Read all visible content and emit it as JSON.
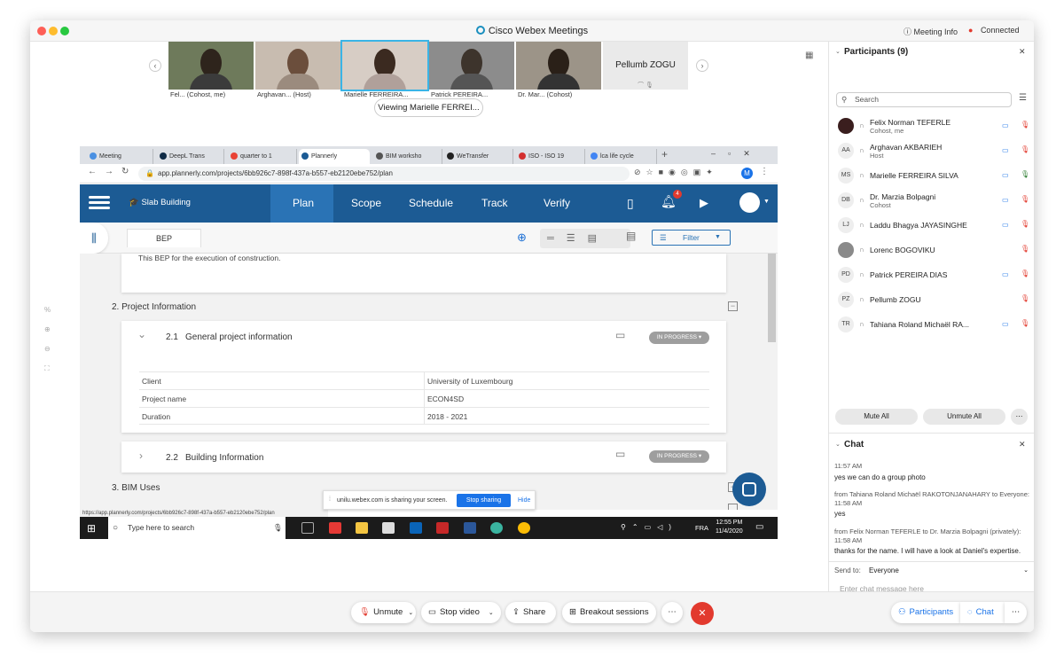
{
  "window": {
    "title": "Cisco Webex Meetings",
    "meeting_info": "Meeting Info",
    "connected": "Connected"
  },
  "video_strip": {
    "thumbs": [
      {
        "name": "Fel...",
        "role": "(Cohost, me)"
      },
      {
        "name": "Arghavan...",
        "role": "(Host)"
      },
      {
        "name": "Marielle FERREIRA...",
        "role": ""
      },
      {
        "name": "Patrick PEREIRA...",
        "role": ""
      },
      {
        "name": "Dr. Mar...",
        "role": "(Cohost)"
      }
    ],
    "tile_name": "Pellumb ZOGU",
    "viewing": "Viewing Marielle FERREI..."
  },
  "browser": {
    "tabs": [
      "Meeting",
      "DeepL Trans",
      "quarter to 1",
      "Plannerly",
      "BIM worksho",
      "WeTransfer",
      "ISO - ISO 19",
      "lca life cycle"
    ],
    "url": "app.plannerly.com/projects/6bb926c7-898f-437a-b557-eb2120ebe752/plan",
    "status_url": "https://app.plannerly.com/projects/6bb926c7-898f-437a-b557-eb2120ebe752/plan"
  },
  "plannerly": {
    "project": "Slab Building",
    "nav": [
      "Plan",
      "Scope",
      "Schedule",
      "Track",
      "Verify"
    ],
    "notif_count": "4",
    "tab": "BEP",
    "filter": "Filter",
    "intro_text": "This BEP for the execution of construction.",
    "section2": "2. Project Information",
    "sub21_num": "2.1",
    "sub21_title": "General project information",
    "status": "IN PROGRESS",
    "table": [
      {
        "label": "Client",
        "value": "University of Luxembourg"
      },
      {
        "label": "Project name",
        "value": "ECON4SD"
      },
      {
        "label": "Duration",
        "value": "2018 - 2021"
      }
    ],
    "sub22_num": "2.2",
    "sub22_title": "Building Information",
    "section3": "3. BIM Uses",
    "sharing_text": "unilu.webex.com is sharing your screen.",
    "stop_sharing": "Stop sharing",
    "hide": "Hide"
  },
  "taskbar": {
    "search": "Type here to search",
    "lang": "FRA",
    "time": "12:55 PM",
    "date": "11/4/2020"
  },
  "participants": {
    "title": "Participants (9)",
    "search_placeholder": "Search",
    "list": [
      {
        "name": "Felix Norman TEFERLE",
        "role": "Cohost, me",
        "initials": ""
      },
      {
        "name": "Arghavan AKBARIEH",
        "role": "Host",
        "initials": "AA"
      },
      {
        "name": "Marielle FERREIRA SILVA",
        "role": "",
        "initials": "MS"
      },
      {
        "name": "Dr. Marzia Bolpagni",
        "role": "Cohost",
        "initials": "DB"
      },
      {
        "name": "Laddu Bhagya JAYASINGHE",
        "role": "",
        "initials": "LJ"
      },
      {
        "name": "Lorenc BOGOVIKU",
        "role": "",
        "initials": ""
      },
      {
        "name": "Patrick PEREIRA DIAS",
        "role": "",
        "initials": "PD"
      },
      {
        "name": "Pellumb ZOGU",
        "role": "",
        "initials": "PZ"
      },
      {
        "name": "Tahiana Roland Michaël RA...",
        "role": "",
        "initials": "TR"
      }
    ],
    "mute_all": "Mute All",
    "unmute_all": "Unmute All"
  },
  "chat": {
    "title": "Chat",
    "messages": [
      {
        "meta": "11:57  AM",
        "text": "yes we can do a group photo"
      },
      {
        "meta": "from Tahiana Roland Michaël RAKOTONJANAHARY to Everyone:",
        "time": "11:58  AM",
        "text": "yes"
      },
      {
        "meta": "from Felix Norman TEFERLE to Dr. Marzia Bolpagni (privately):",
        "time": "11:58  AM",
        "text": "thanks for the name. I will have a look at Daniel's expertise."
      }
    ],
    "send_to_label": "Send to:",
    "send_to_value": "Everyone",
    "placeholder": "Enter chat message here"
  },
  "controls": {
    "unmute": "Unmute",
    "stop_video": "Stop video",
    "share": "Share",
    "breakout": "Breakout sessions",
    "participants": "Participants",
    "chat": "Chat"
  },
  "colors": {
    "accent": "#1c5b94",
    "end_call": "#e23a2e",
    "webex_blue": "#0d67d6"
  }
}
